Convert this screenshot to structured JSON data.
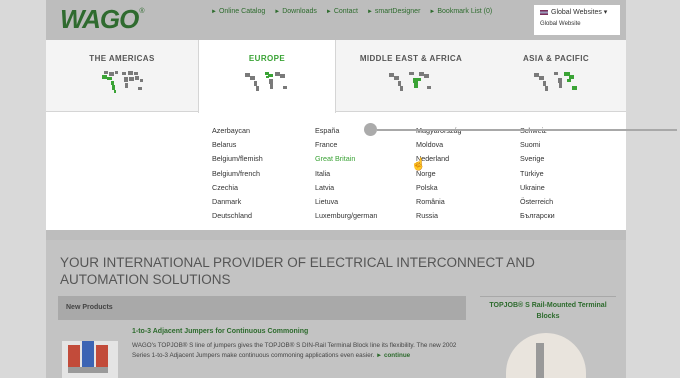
{
  "brand": {
    "logo_text": "WAGO",
    "reg_mark": "®"
  },
  "topnav": [
    {
      "icon": "arrow-right-icon",
      "label": "Online Catalog"
    },
    {
      "icon": "arrow-right-icon",
      "label": "Downloads"
    },
    {
      "icon": "arrow-right-icon",
      "label": "Contact"
    },
    {
      "icon": "arrow-right-icon",
      "label": "smartDesigner"
    },
    {
      "icon": "arrow-right-icon",
      "label": "Bookmark List (0)"
    }
  ],
  "global_menu": {
    "label": "Global Websites ▾",
    "sub_label": "Global Website"
  },
  "regions": [
    {
      "label": "THE AMERICAS"
    },
    {
      "label": "EUROPE"
    },
    {
      "label": "MIDDLE EAST & AFRICA"
    },
    {
      "label": "ASIA & PACIFIC"
    }
  ],
  "countries": {
    "col1": [
      "Azerbaycan",
      "Belarus",
      "Belgium/flemish",
      "Belgium/french",
      "Czechia",
      "Danmark",
      "Deutschland"
    ],
    "col2": [
      "España",
      "France",
      "Great Britain",
      "Italia",
      "Latvia",
      "Lietuva",
      "Luxemburg/german"
    ],
    "col3": [
      "Magyarország",
      "Moldova",
      "Nederland",
      "Norge",
      "Polska",
      "România",
      "Russia"
    ],
    "col4": [
      "Schweiz",
      "Suomi",
      "Sverige",
      "Türkiye",
      "Ukraine",
      "Österreich",
      "Български"
    ]
  },
  "main": {
    "headline": "YOUR INTERNATIONAL PROVIDER OF ELECTRICAL INTERCONNECT AND AUTOMATION SOLUTIONS",
    "section_label": "New Products",
    "product_title": "1-to-3 Adjacent Jumpers for Continuous Commoning",
    "product_desc": "WAGO's TOPJOB® S line of jumpers gives the TOPJOB® S DIN-Rail Terminal Block line its flexibility. The new 2002 Series 1-to-3 Adjacent Jumpers make continuous commoning applications even easier.",
    "more_label": "► continue",
    "side_title": "TOPJOB® S Rail-Mounted Terminal Blocks"
  },
  "colors": {
    "accent_green": "#3aa335",
    "brand_green": "#2f6b2f"
  }
}
